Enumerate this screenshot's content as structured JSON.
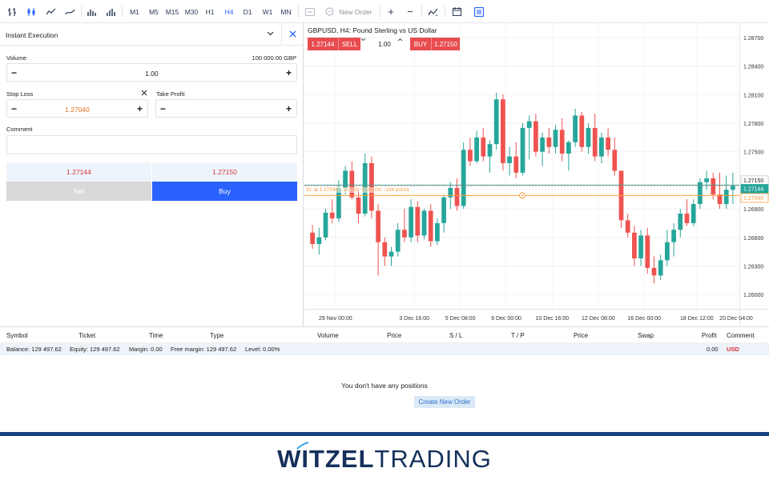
{
  "toolbar": {
    "timeframes": [
      "M1",
      "M5",
      "M15",
      "M30",
      "H1",
      "H4",
      "D1",
      "W1",
      "MN"
    ],
    "active_timeframe": "H4",
    "new_order_label": "New Order"
  },
  "order_panel": {
    "execution_type": "Instant Execution",
    "volume_label": "Volume",
    "volume_value": "1.00",
    "volume_amount": "100 000.00 GBP",
    "stop_loss_label": "Stop Loss",
    "stop_loss_value": "1.27040",
    "take_profit_label": "Take Profit",
    "take_profit_value": "",
    "comment_label": "Comment",
    "comment_value": "",
    "sell_price": "1.27144",
    "buy_price": "1.27150",
    "sell_label": "Sell",
    "buy_label": "Buy"
  },
  "chart": {
    "title": "GBPUSD, H4: Pound Sterling vs US Dollar",
    "sell_price": "1.27144",
    "sell_label": "SELL",
    "volume": "1.00",
    "buy_label": "BUY",
    "buy_price": "1.27150",
    "sl_line_label": "SL at 1.27040, -107.00 -0.00104, -104 points",
    "price_tags": [
      "1.27150",
      "1.27144",
      "1.27040"
    ],
    "colors": {
      "bull": "#26a69a",
      "bear": "#ef5350",
      "sl": "#ff9e3d",
      "accent": "#2962ff"
    }
  },
  "chart_data": {
    "type": "candlestick",
    "title": "GBPUSD, H4: Pound Sterling vs US Dollar",
    "ylim": [
      1.2585,
      1.2885
    ],
    "y_ticks": [
      "1.28700",
      "1.28400",
      "1.28100",
      "1.27800",
      "1.27500",
      "1.27150",
      "1.27144",
      "1.27040",
      "1.26900",
      "1.26600",
      "1.26300",
      "1.26000"
    ],
    "x_ticks": [
      "29 Nov 00:00",
      "3 Dec 16:00",
      "5 Dec 08:00",
      "9 Dec 00:00",
      "10 Dec 16:00",
      "12 Dec 08:00",
      "16 Dec 00:00",
      "18 Dec 12:00",
      "20 Dec 04:00"
    ],
    "lines": {
      "buy": 1.2715,
      "sell": 1.27144,
      "stop_loss": 1.2704
    },
    "candles": [
      [
        1.2665,
        1.2673,
        1.2648,
        1.2653
      ],
      [
        1.2653,
        1.267,
        1.2642,
        1.266
      ],
      [
        1.266,
        1.269,
        1.2657,
        1.2686
      ],
      [
        1.2686,
        1.27,
        1.2675,
        1.268
      ],
      [
        1.268,
        1.272,
        1.2676,
        1.2712
      ],
      [
        1.2712,
        1.2735,
        1.2705,
        1.273
      ],
      [
        1.273,
        1.274,
        1.27,
        1.2702
      ],
      [
        1.2702,
        1.271,
        1.2675,
        1.2685
      ],
      [
        1.2685,
        1.2748,
        1.2682,
        1.2738
      ],
      [
        1.2738,
        1.2745,
        1.268,
        1.2688
      ],
      [
        1.2688,
        1.2695,
        1.262,
        1.2655
      ],
      [
        1.2655,
        1.266,
        1.263,
        1.264
      ],
      [
        1.264,
        1.265,
        1.263,
        1.2645
      ],
      [
        1.2645,
        1.2675,
        1.264,
        1.2668
      ],
      [
        1.2668,
        1.269,
        1.2655,
        1.266
      ],
      [
        1.266,
        1.27,
        1.2655,
        1.2692
      ],
      [
        1.2692,
        1.2698,
        1.2655,
        1.2662
      ],
      [
        1.2662,
        1.269,
        1.2658,
        1.2688
      ],
      [
        1.2688,
        1.2695,
        1.265,
        1.2656
      ],
      [
        1.2656,
        1.268,
        1.2652,
        1.2675
      ],
      [
        1.2675,
        1.2705,
        1.2665,
        1.2702
      ],
      [
        1.2702,
        1.2718,
        1.269,
        1.2712
      ],
      [
        1.2712,
        1.2722,
        1.2688,
        1.2693
      ],
      [
        1.2693,
        1.276,
        1.269,
        1.2752
      ],
      [
        1.2752,
        1.2765,
        1.2735,
        1.274
      ],
      [
        1.274,
        1.2772,
        1.2738,
        1.2765
      ],
      [
        1.2765,
        1.2775,
        1.274,
        1.2745
      ],
      [
        1.2745,
        1.2762,
        1.2728,
        1.2758
      ],
      [
        1.2758,
        1.2812,
        1.2752,
        1.2805
      ],
      [
        1.2805,
        1.281,
        1.273,
        1.2738
      ],
      [
        1.2738,
        1.2755,
        1.2725,
        1.2745
      ],
      [
        1.2745,
        1.276,
        1.2722,
        1.2728
      ],
      [
        1.2728,
        1.278,
        1.2725,
        1.2775
      ],
      [
        1.2775,
        1.2788,
        1.2742,
        1.2782
      ],
      [
        1.2782,
        1.279,
        1.2745,
        1.275
      ],
      [
        1.275,
        1.277,
        1.2735,
        1.2765
      ],
      [
        1.2765,
        1.2775,
        1.2748,
        1.2755
      ],
      [
        1.2755,
        1.2778,
        1.2748,
        1.2773
      ],
      [
        1.2773,
        1.2785,
        1.274,
        1.2748
      ],
      [
        1.2748,
        1.2762,
        1.273,
        1.276
      ],
      [
        1.276,
        1.2795,
        1.2755,
        1.2788
      ],
      [
        1.2788,
        1.2792,
        1.275,
        1.2755
      ],
      [
        1.2755,
        1.278,
        1.2748,
        1.2775
      ],
      [
        1.2775,
        1.279,
        1.274,
        1.2745
      ],
      [
        1.2745,
        1.277,
        1.2738,
        1.2765
      ],
      [
        1.2765,
        1.2775,
        1.2745,
        1.2752
      ],
      [
        1.2752,
        1.2765,
        1.2725,
        1.273
      ],
      [
        1.273,
        1.2712,
        1.267,
        1.2678
      ],
      [
        1.2678,
        1.2685,
        1.266,
        1.2665
      ],
      [
        1.2665,
        1.2672,
        1.263,
        1.2638
      ],
      [
        1.2638,
        1.2668,
        1.263,
        1.2662
      ],
      [
        1.2662,
        1.267,
        1.2622,
        1.2628
      ],
      [
        1.2628,
        1.264,
        1.2612,
        1.262
      ],
      [
        1.262,
        1.2642,
        1.2615,
        1.2636
      ],
      [
        1.2636,
        1.2668,
        1.263,
        1.2655
      ],
      [
        1.2655,
        1.2675,
        1.264,
        1.2668
      ],
      [
        1.2668,
        1.269,
        1.266,
        1.2685
      ],
      [
        1.2685,
        1.27,
        1.2672,
        1.2675
      ],
      [
        1.2675,
        1.27,
        1.2672,
        1.2695
      ],
      [
        1.2695,
        1.2722,
        1.269,
        1.2718
      ],
      [
        1.2718,
        1.273,
        1.271,
        1.2722
      ],
      [
        1.2722,
        1.2728,
        1.27,
        1.2705
      ],
      [
        1.2705,
        1.2728,
        1.269,
        1.2695
      ],
      [
        1.2695,
        1.2725,
        1.269,
        1.271
      ],
      [
        1.271,
        1.2728,
        1.2695,
        1.2714
      ]
    ]
  },
  "positions": {
    "columns": [
      "Symbol",
      "Ticket",
      "Time",
      "Type",
      "Volume",
      "Price",
      "S / L",
      "T / P",
      "Price",
      "Swap",
      "Profit",
      "Comment"
    ],
    "balance": "Balance: 129 497.62",
    "equity": "Equity: 129 497.62",
    "margin": "Margin: 0.00",
    "free_margin": "Free margin: 129 497.62",
    "level": "Level: 0.00%",
    "profit": "0.00",
    "currency": "USD",
    "empty_message": "You don't have any positions",
    "create_button": "Create New Order"
  },
  "footer": {
    "brand_part1": "WITZEL",
    "brand_part2": "TRADING"
  }
}
